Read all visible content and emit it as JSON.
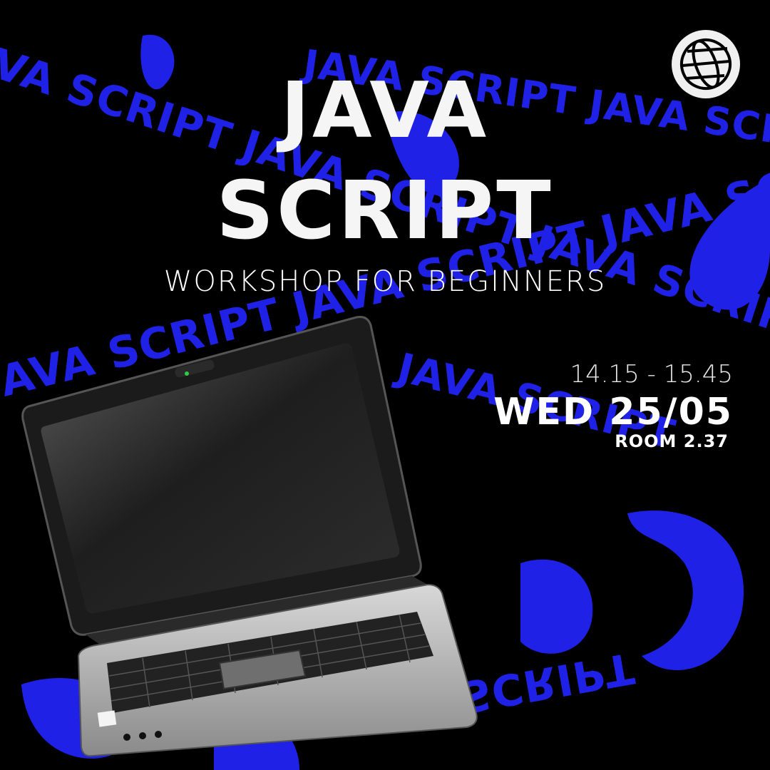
{
  "poster": {
    "title_line_1": "JAVA",
    "title_line_2": "SCRIPT",
    "subtitle": "WORKSHOP FOR BEGINNERS",
    "time": "14.15 - 15.45",
    "date": "WED 25/05",
    "room": "ROOM 2.37"
  },
  "background_text": [
    "JAVA SCRIPT",
    "JAVA SCRIPT",
    "JAVA SCRIPT",
    "JAVA SCRIPT",
    "JAVA SCRIPT",
    "JAVA SCRIPT",
    "JAVA SCRIPT",
    "JAVA SCRIPT",
    "JAVA SCRIPT",
    "JAVA SCRIPT"
  ],
  "icons": {
    "logo": "globe-icon",
    "illustration": "laptop-icon"
  },
  "colors": {
    "background": "#000000",
    "accent_blue": "#1f22e6",
    "text": "#f5f5f5"
  }
}
